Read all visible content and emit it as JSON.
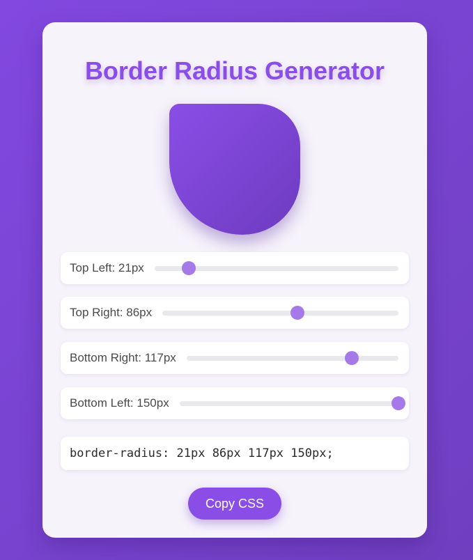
{
  "title": "Border Radius Generator",
  "colors": {
    "accent": "#8a4ee6",
    "thumb": "#a57ae8",
    "background": "#7b45d6",
    "card": "#f6f3fb"
  },
  "controls": [
    {
      "label": "Top Left: 21px",
      "value": 21,
      "max": 150
    },
    {
      "label": "Top Right: 86px",
      "value": 86,
      "max": 150
    },
    {
      "label": "Bottom Right: 117px",
      "value": 117,
      "max": 150
    },
    {
      "label": "Bottom Left: 150px",
      "value": 150,
      "max": 150
    }
  ],
  "css_output": "border-radius: 21px 86px 117px 150px;",
  "copy_button_label": "Copy CSS"
}
